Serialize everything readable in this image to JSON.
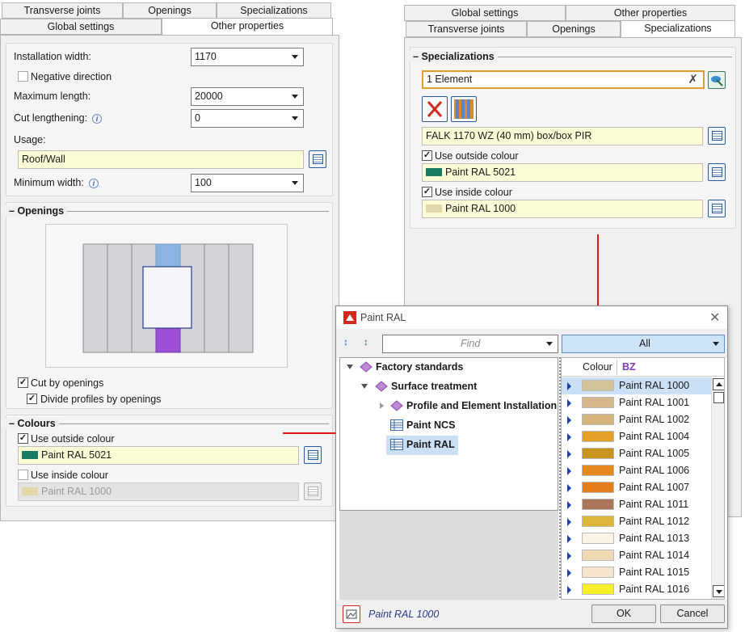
{
  "left": {
    "tabs_row1": [
      "Transverse joints",
      "Openings",
      "Specializations"
    ],
    "tabs_row2": [
      "Global settings",
      "Other properties"
    ],
    "installation_width_label": "Installation width:",
    "installation_width_value": "1170",
    "negative_direction_label": "Negative direction",
    "maximum_length_label": "Maximum length:",
    "maximum_length_value": "20000",
    "cut_lengthening_label": "Cut lengthening:",
    "cut_lengthening_value": "0",
    "usage_label": "Usage:",
    "usage_value": "Roof/Wall",
    "minimum_width_label": "Minimum width:",
    "minimum_width_value": "100",
    "openings_title": "Openings",
    "cut_by_openings_label": "Cut by openings",
    "divide_profiles_label": "Divide profiles by openings",
    "colours_title": "Colours",
    "use_outside_colour_label": "Use outside colour",
    "outside_colour_value": "Paint RAL 5021",
    "outside_colour_hex": "#1a7a63",
    "use_inside_colour_label": "Use inside colour",
    "inside_colour_value": "Paint RAL 1000",
    "inside_colour_hex": "#e3d6a8",
    "info_glyph": "i"
  },
  "right": {
    "tabs_row1": [
      "Global settings",
      "Other properties"
    ],
    "tabs_row2": [
      "Transverse joints",
      "Openings",
      "Specializations"
    ],
    "specializations_title": "Specializations",
    "element_value": "1 Element",
    "profile_value": "FALK 1170 WZ (40 mm) box/box PIR",
    "use_outside_colour_label": "Use outside colour",
    "outside_colour_value": "Paint RAL 5021",
    "use_inside_colour_label": "Use inside colour",
    "inside_colour_value": "Paint RAL 1000"
  },
  "dialog": {
    "title": "Paint RAL",
    "find_placeholder": "Find",
    "filter_value": "All",
    "tree": {
      "factory_standards": "Factory standards",
      "surface_treatment": "Surface treatment",
      "profile_element_installation": "Profile and Element Installation",
      "paint_ncs": "Paint NCS",
      "paint_ral": "Paint RAL"
    },
    "columns": [
      "Colour",
      "BZ"
    ],
    "rows": [
      {
        "name": "Paint RAL 1000",
        "color": "#d3c49a"
      },
      {
        "name": "Paint RAL 1001",
        "color": "#d7b88c"
      },
      {
        "name": "Paint RAL 1002",
        "color": "#d4b47c"
      },
      {
        "name": "Paint RAL 1004",
        "color": "#e3a12a"
      },
      {
        "name": "Paint RAL 1005",
        "color": "#c99320"
      },
      {
        "name": "Paint RAL 1006",
        "color": "#e5891e"
      },
      {
        "name": "Paint RAL 1007",
        "color": "#e27c1c"
      },
      {
        "name": "Paint RAL 1011",
        "color": "#a8775a"
      },
      {
        "name": "Paint RAL 1012",
        "color": "#dcb63a"
      },
      {
        "name": "Paint RAL 1013",
        "color": "#fbf3e3"
      },
      {
        "name": "Paint RAL 1014",
        "color": "#f0dab4"
      },
      {
        "name": "Paint RAL 1015",
        "color": "#f6e6cf"
      },
      {
        "name": "Paint RAL 1016",
        "color": "#f5f02a"
      }
    ],
    "status_value": "Paint RAL 1000",
    "ok_label": "OK",
    "cancel_label": "Cancel"
  }
}
